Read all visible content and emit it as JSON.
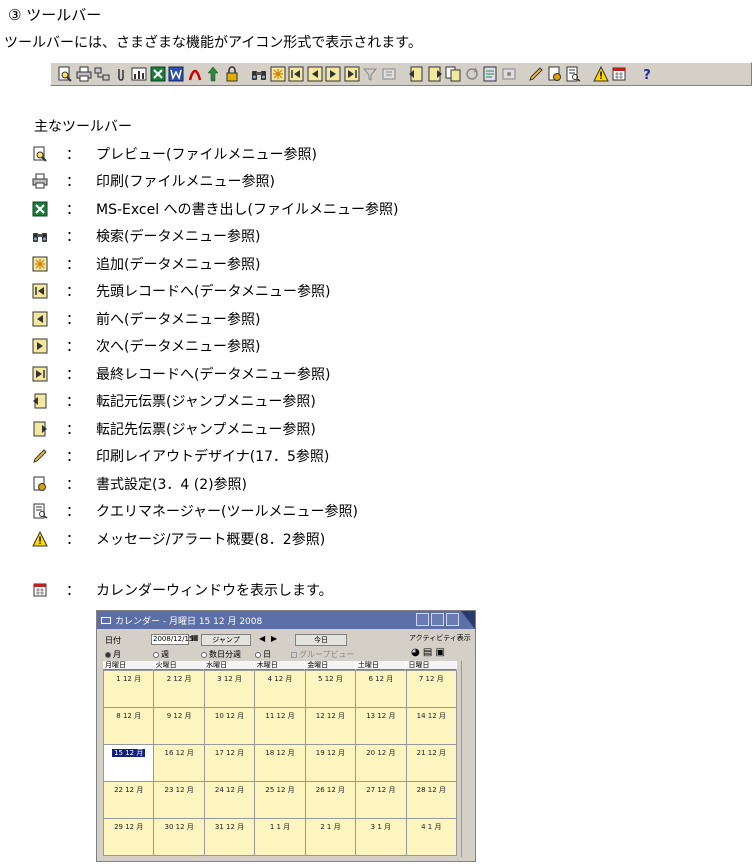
{
  "heading": "③ ツールバー",
  "intro": "ツールバーには、さまざまな機能がアイコン形式で表示されます。",
  "legend_title": "主なツールバー",
  "colon": "：",
  "legend": [
    {
      "icon": "preview-icon",
      "text": "プレビュー(ファイルメニュー参照)"
    },
    {
      "icon": "print-icon",
      "text": "印刷(ファイルメニュー参照)"
    },
    {
      "icon": "excel-export-icon",
      "text": "MS-Excel への書き出し(ファイルメニュー参照)"
    },
    {
      "icon": "binoculars-search-icon",
      "text": "検索(データメニュー参照)"
    },
    {
      "icon": "add-record-icon",
      "text": "追加(データメニュー参照)"
    },
    {
      "icon": "first-record-icon",
      "text": "先頭レコードへ(データメニュー参照)"
    },
    {
      "icon": "previous-record-icon",
      "text": "前へ(データメニュー参照)"
    },
    {
      "icon": "next-record-icon",
      "text": "次へ(データメニュー参照)"
    },
    {
      "icon": "last-record-icon",
      "text": "最終レコードへ(データメニュー参照)"
    },
    {
      "icon": "source-slip-icon",
      "text": "転記元伝票(ジャンプメニュー参照)"
    },
    {
      "icon": "target-slip-icon",
      "text": "転記先伝票(ジャンプメニュー参照)"
    },
    {
      "icon": "pencil-layout-icon",
      "text": "印刷レイアウトデザイナ(17．5参照)"
    },
    {
      "icon": "format-settings-icon",
      "text": "書式設定(3．4 (2)参照)"
    },
    {
      "icon": "query-manager-icon",
      "text": "クエリマネージャー(ツールメニュー参照)"
    },
    {
      "icon": "warning-icon",
      "text": "メッセージ/アラート概要(8．2参照)"
    }
  ],
  "calendar_line": "カレンダーウィンドウを表示します。",
  "calendar": {
    "title": "カレンダー - 月曜日 15 12 月 2008",
    "date_label": "日付",
    "date_value": "2008/12/15",
    "jump_label": "ジャンプ",
    "today_label": "今日",
    "activity_label": "アクティビティ表示",
    "views": [
      "月",
      "週",
      "数日分週",
      "日"
    ],
    "group_view": "グループビュー",
    "weekdays": [
      "月曜日",
      "火曜日",
      "水曜日",
      "木曜日",
      "金曜日",
      "土曜日",
      "日曜日"
    ],
    "cells": [
      "1 12 月",
      "2 12 月",
      "3 12 月",
      "4 12 月",
      "5 12 月",
      "6 12 月",
      "7 12 月",
      "8 12 月",
      "9 12 月",
      "10 12 月",
      "11 12 月",
      "12 12 月",
      "13 12 月",
      "14 12 月",
      "15 12 月",
      "16 12 月",
      "17 12 月",
      "18 12 月",
      "19 12 月",
      "20 12 月",
      "21 12 月",
      "22 12 月",
      "23 12 月",
      "24 12 月",
      "25 12 月",
      "26 12 月",
      "27 12 月",
      "28 12 月",
      "29 12 月",
      "30 12 月",
      "31 12 月",
      "1 1 月",
      "2 1 月",
      "3 1 月",
      "4 1 月"
    ],
    "selected_index": 14
  }
}
